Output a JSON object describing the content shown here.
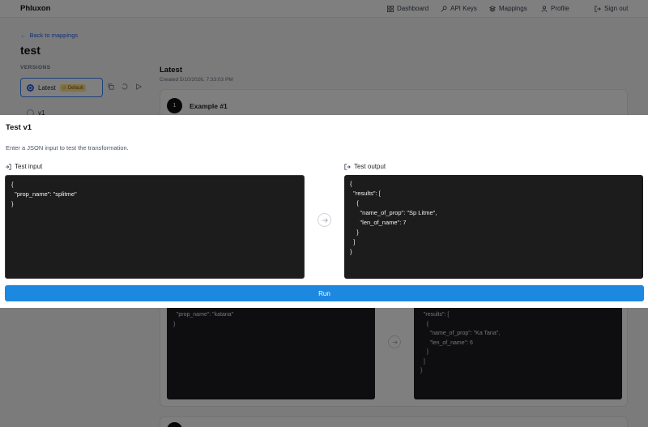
{
  "app": {
    "brand": "Phluxon"
  },
  "nav": {
    "dashboard": "Dashboard",
    "api_keys": "API Keys",
    "mappings": "Mappings",
    "profile": "Profile",
    "sign_out": "Sign out"
  },
  "page": {
    "back": "Back to mappings",
    "title": "test",
    "versions_label": "VERSIONS"
  },
  "versions": [
    {
      "name": "Latest",
      "badge": "Default",
      "selected": true
    },
    {
      "name": "v1",
      "selected": false
    }
  ],
  "main": {
    "title": "Latest",
    "created": "Created 5/10/2026, 7:33:03 PM",
    "example": {
      "number": "1",
      "title": "Example #1",
      "input_text": "  \"prop_name\": \"katana\"\n}",
      "output_text": "  \"results\": [\n    {\n      \"name_of_prop\": \"Ka Tana\",\n      \"len_of_name\": 6\n    }\n  ]\n}"
    }
  },
  "dialog": {
    "title": "Test v1",
    "description": "Enter a JSON input to test the transformation.",
    "input_label": "Test input",
    "output_label": "Test output",
    "input_value": "{\n  \"prop_name\": \"splitme\"\n}",
    "output_value": "{\n  \"results\": [\n    {\n      \"name_of_prop\": \"Sp Litme\",\n      \"len_of_name\": 7\n    }\n  ]\n}",
    "run_label": "Run"
  },
  "colors": {
    "accent": "#1d88e0",
    "link": "#2563eb",
    "code_bg": "#1c1c1c",
    "badge_bg": "#fde68a"
  }
}
